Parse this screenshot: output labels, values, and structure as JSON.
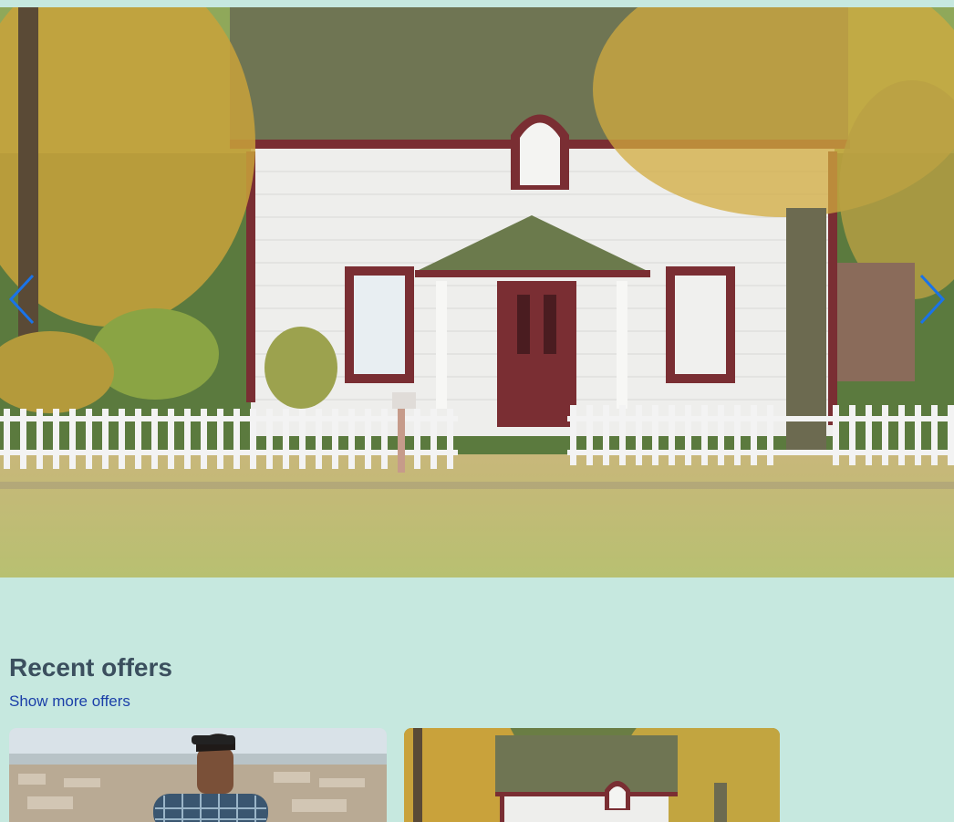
{
  "carousel": {
    "image_alt": "White house with red trim behind picket fence in autumn",
    "prev_icon": "chevron-left-icon",
    "next_icon": "chevron-right-icon",
    "accent_color": "#1a73e8"
  },
  "offers": {
    "title": "Recent offers",
    "show_more": "Show more offers",
    "cards": [
      {
        "image": "man with sunglasses over city view"
      },
      {
        "image": "white house with autumn trees"
      }
    ]
  }
}
